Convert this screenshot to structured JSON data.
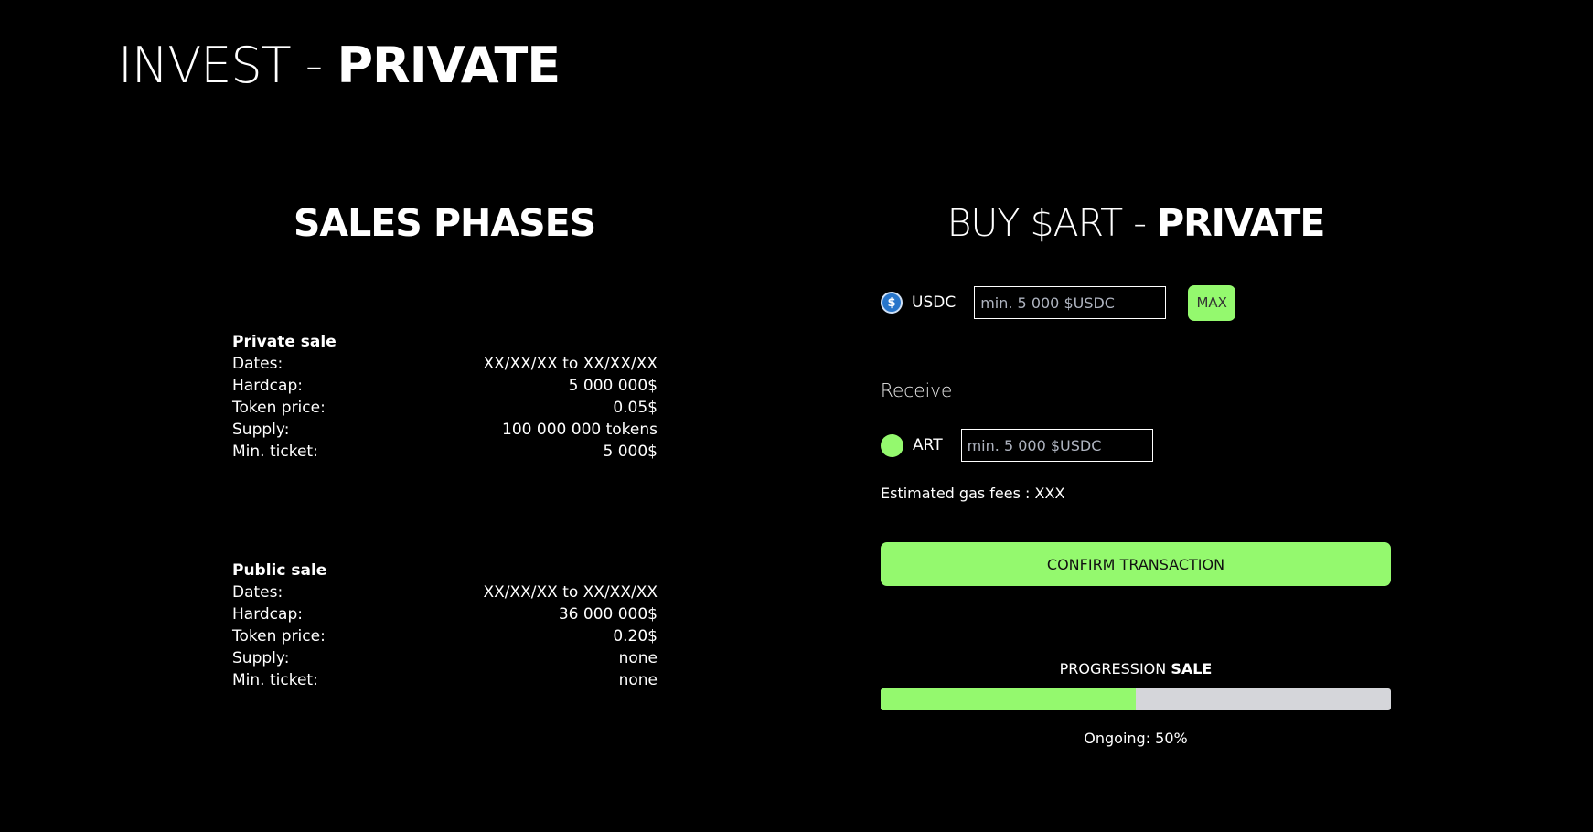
{
  "header": {
    "title_light": "INVEST - ",
    "title_bold": "PRIVATE"
  },
  "phases": {
    "title": "SALES PHASES",
    "private": {
      "name": "Private sale",
      "rows": [
        {
          "label": "Dates:",
          "value": "XX/XX/XX to XX/XX/XX"
        },
        {
          "label": "Hardcap:",
          "value": "5 000 000$"
        },
        {
          "label": "Token price:",
          "value": "0.05$"
        },
        {
          "label": "Supply:",
          "value": "100 000 000 tokens"
        },
        {
          "label": "Min. ticket:",
          "value": "5 000$"
        }
      ]
    },
    "public": {
      "name": "Public sale",
      "rows": [
        {
          "label": "Dates:",
          "value": "XX/XX/XX to XX/XX/XX"
        },
        {
          "label": "Hardcap:",
          "value": "36 000 000$"
        },
        {
          "label": "Token price:",
          "value": "0.20$"
        },
        {
          "label": "Supply:",
          "value": "none"
        },
        {
          "label": "Min. ticket:",
          "value": "none"
        }
      ]
    }
  },
  "buy": {
    "title_light": "BUY $ART - ",
    "title_bold": "PRIVATE",
    "pay": {
      "token": "USDC",
      "icon": "usdc-coin-icon",
      "icon_glyph": "$",
      "placeholder": "min. 5 000 $USDC",
      "max_label": "MAX"
    },
    "receive_label": "Receive",
    "receive": {
      "token": "ART",
      "icon": "art-token-icon",
      "placeholder": "min. 5 000 $USDC"
    },
    "gas_fees": "Estimated gas fees : XXX",
    "confirm_label": "CONFIRM TRANSACTION"
  },
  "progress": {
    "title_light": "PROGRESSION ",
    "title_bold": "SALE",
    "fraction": 0.5,
    "status": "Ongoing: 50%"
  },
  "colors": {
    "accent": "#94f96e",
    "background": "#000000",
    "track": "#d5d6da",
    "usdc": "#2775ca"
  }
}
